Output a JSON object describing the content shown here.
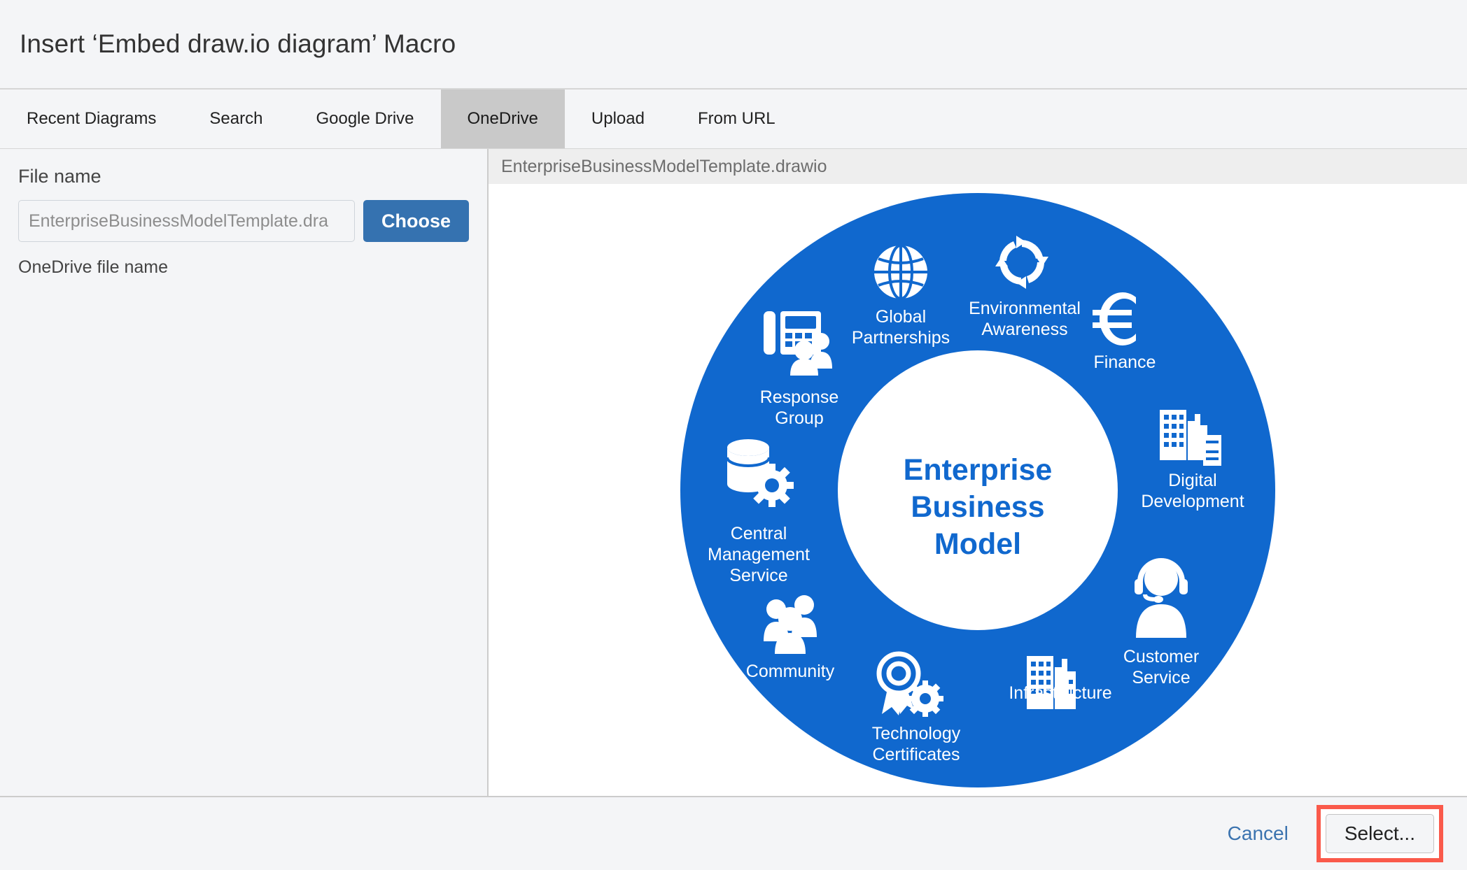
{
  "dialog": {
    "title": "Insert ‘Embed draw.io diagram’ Macro"
  },
  "tabs": [
    {
      "label": "Recent Diagrams",
      "active": false
    },
    {
      "label": "Search",
      "active": false
    },
    {
      "label": "Google Drive",
      "active": false
    },
    {
      "label": "OneDrive",
      "active": true
    },
    {
      "label": "Upload",
      "active": false
    },
    {
      "label": "From URL",
      "active": false
    }
  ],
  "left_pane": {
    "field_label": "File name",
    "input_value": "EnterpriseBusinessModelTemplate.dra",
    "input_placeholder": "EnterpriseBusinessModelTemplate.dra",
    "choose_label": "Choose",
    "hint": "OneDrive file name"
  },
  "preview": {
    "header_filename": "EnterpriseBusinessModelTemplate.drawio"
  },
  "footer": {
    "cancel_label": "Cancel",
    "select_label": "Select...",
    "highlight_color": "#fa5a4b"
  },
  "colors": {
    "ring_blue": "#1068ce",
    "center_text_blue": "#1068ce",
    "choose_button_blue": "#3572b0",
    "active_tab_gray": "#c9c9c9",
    "link_blue": "#3b73af"
  },
  "chart_data": {
    "type": "donut-diagram",
    "title": "Enterprise Business Model",
    "center_lines": [
      "Enterprise",
      "Business",
      "Model"
    ],
    "ring_color": "#1068ce",
    "segments": [
      {
        "label": "Global Partnerships",
        "lines": [
          "Global",
          "Partnerships"
        ],
        "icon": "globe-icon",
        "angle_deg": -65
      },
      {
        "label": "Environmental Awareness",
        "lines": [
          "Environmental",
          "Awareness"
        ],
        "icon": "recycle-icon",
        "angle_deg": -25
      },
      {
        "label": "Finance",
        "lines": [
          "Finance"
        ],
        "icon": "euro-icon",
        "angle_deg": 5
      },
      {
        "label": "Digital Development",
        "lines": [
          "Digital",
          "Development"
        ],
        "icon": "buildings-server-icon",
        "angle_deg": 42
      },
      {
        "label": "Customer Service",
        "lines": [
          "Customer",
          "Service"
        ],
        "icon": "headset-agent-icon",
        "angle_deg": 78
      },
      {
        "label": "Infrastructure",
        "lines": [
          "Infrastructure"
        ],
        "icon": "city-buildings-icon",
        "angle_deg": 115
      },
      {
        "label": "Technology Certificates",
        "lines": [
          "Technology",
          "Certificates"
        ],
        "icon": "award-gear-icon",
        "angle_deg": 148
      },
      {
        "label": "Community",
        "lines": [
          "Community"
        ],
        "icon": "people-group-icon",
        "angle_deg": 190
      },
      {
        "label": "Central Management Service",
        "lines": [
          "Central",
          "Management",
          "Service"
        ],
        "icon": "database-gear-icon",
        "angle_deg": 222
      },
      {
        "label": "Response Group",
        "lines": [
          "Response",
          "Group"
        ],
        "icon": "desk-phone-people-icon",
        "angle_deg": 258
      }
    ]
  },
  "diagram_text": {
    "global_partnerships_1": "Global",
    "global_partnerships_2": "Partnerships",
    "environmental_1": "Environmental",
    "environmental_2": "Awareness",
    "finance_1": "Finance",
    "digital_1": "Digital",
    "digital_2": "Development",
    "customer_1": "Customer",
    "customer_2": "Service",
    "infrastructure_1": "Infrastructure",
    "technology_1": "Technology",
    "technology_2": "Certificates",
    "community_1": "Community",
    "central_1": "Central",
    "central_2": "Management",
    "central_3": "Service",
    "response_1": "Response",
    "response_2": "Group",
    "center_1": "Enterprise",
    "center_2": "Business",
    "center_3": "Model"
  }
}
